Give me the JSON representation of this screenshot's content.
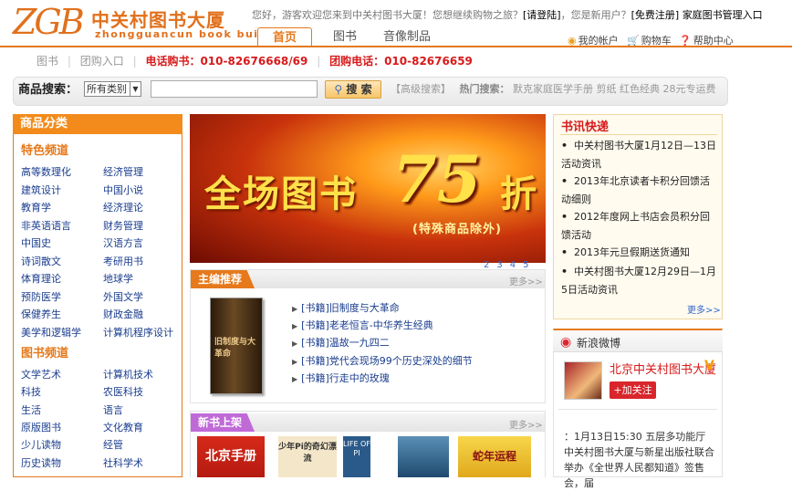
{
  "header": {
    "logo_mark": "ZGB",
    "logo_cn": "中关村图书大厦",
    "logo_en": "zhongguancun book building",
    "welcome_prefix": "您好，游客欢迎您来到中关村图书大厦！您想继续购物之旅？",
    "login": "[请登陆]",
    "new_user": "，您是新用户？",
    "register": "[免费注册]",
    "manage": "家庭图书管理入口",
    "tabs": [
      "首页",
      "图书",
      "音像制品"
    ],
    "account": "我的帐户",
    "cart": "购物车",
    "help": "帮助中心"
  },
  "subbar": {
    "items": [
      "图书",
      "团购入口"
    ],
    "phone_label": "电话购书：010-82676668/69",
    "group_phone": "团购电话：010-82676659"
  },
  "search": {
    "label": "商品搜索：",
    "category": "所有类别",
    "button": "搜 索",
    "advanced": "【高级搜索】",
    "hot_label": "热门搜索：",
    "hot_terms": [
      "默克家庭医学手册",
      "剪纸",
      "红色经典",
      "28元专运费"
    ]
  },
  "sidebar": {
    "title": "商品分类",
    "featured_title": "特色频道",
    "featured": [
      [
        "高等数理化",
        "经济管理"
      ],
      [
        "建筑设计",
        "中国小说"
      ],
      [
        "教育学",
        "经济理论"
      ],
      [
        "非英语语言",
        "财务管理"
      ],
      [
        "中国史",
        "汉语方言"
      ],
      [
        "诗词散文",
        "考研用书"
      ],
      [
        "体育理论",
        "地球学"
      ],
      [
        "预防医学",
        "外国文学"
      ],
      [
        "保健养生",
        "财政金融"
      ],
      [
        "美学和逻辑学",
        "计算机程序设计"
      ]
    ],
    "books_title": "图书频道",
    "books": [
      [
        "文学艺术",
        "计算机技术"
      ],
      [
        "科技",
        "农医科技"
      ],
      [
        "生活",
        "语言"
      ],
      [
        "原版图书",
        "文化教育"
      ],
      [
        "少儿读物",
        "经管"
      ],
      [
        "历史读物",
        "社科学术"
      ]
    ]
  },
  "banner": {
    "main": "全场图书",
    "number": "75",
    "suffix": "折",
    "sub": "(特殊商品除外)",
    "pages": [
      "2",
      "3",
      "4",
      "5"
    ]
  },
  "picks": {
    "title": "主编推荐",
    "more": "更多>>",
    "cover_text": "旧制度与大革命",
    "items": [
      "[书籍]旧制度与大革命",
      "[书籍]老老恒言-中华养生经典",
      "[书籍]温故一九四二",
      "[书籍]党代会现场99个历史深处的细节",
      "[书籍]行走中的玫瑰"
    ]
  },
  "new_books": {
    "title": "新书上架",
    "more": "更多>>",
    "covers": [
      "北京手册",
      "少年Pi的奇幻漂流",
      "LIFE OF PI",
      "蛇年运程"
    ]
  },
  "news": {
    "title": "书讯快递",
    "items": [
      "中关村图书大厦1月12日—13日活动资讯",
      "2013年北京读者卡积分回馈活动细则",
      "2012年度网上书店会员积分回馈活动",
      "2013年元旦假期送货通知",
      "中关村图书大厦12月29日—1月5日活动资讯"
    ],
    "more": "更多>>"
  },
  "weibo": {
    "title": "新浪微博",
    "name": "北京中关村图书大厦",
    "follow": "+加关注",
    "post": "：1月13日15:30 五层多功能厅 中关村图书大厦与新星出版社联合举办《全世界人民都知道》签售会，届"
  },
  "colors": {
    "brand_orange": "#e5791b",
    "link_blue": "#1a3d8f",
    "alert_red": "#d71a1a"
  }
}
